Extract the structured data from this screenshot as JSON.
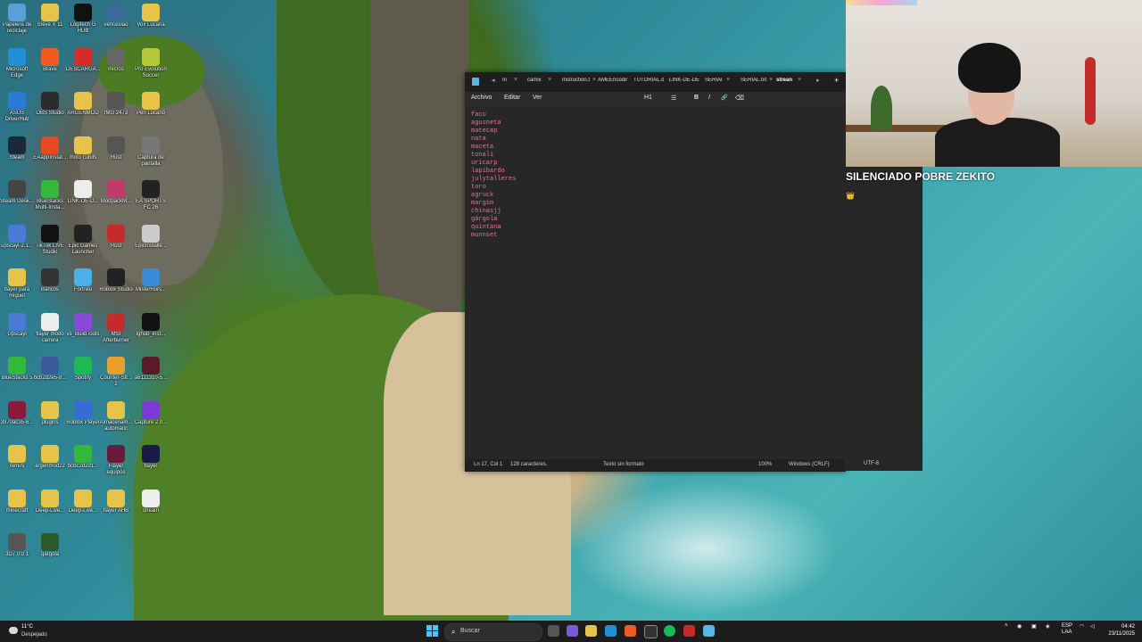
{
  "desktop": {
    "icons": [
      {
        "label": "Papelera de reciclaje",
        "icon": "recycle-bin-icon",
        "color": "#5aa0d8"
      },
      {
        "label": "Steve X 11",
        "icon": "folder-icon",
        "color": "#e8c34a"
      },
      {
        "label": "Logitech G HUB",
        "icon": "logitech-icon",
        "color": "#111111"
      },
      {
        "label": "venceslao",
        "icon": "image-icon",
        "color": "#3a6a9a"
      },
      {
        "label": "Vox Lucaria",
        "icon": "folder-icon",
        "color": "#e8c34a"
      },
      {
        "label": "Microsoft Edge",
        "icon": "edge-icon",
        "color": "#1f8fd6"
      },
      {
        "label": "Brave",
        "icon": "brave-icon",
        "color": "#f25a24"
      },
      {
        "label": "DESCARGA...",
        "icon": "pdf-icon",
        "color": "#d62b2b"
      },
      {
        "label": "micros",
        "icon": "image-icon",
        "color": "#666666"
      },
      {
        "label": "Pro Evolution Soccer",
        "icon": "game-icon",
        "color": "#b6c83a"
      },
      {
        "label": "ASUS DriverHub",
        "icon": "asus-icon",
        "color": "#2a7ad6"
      },
      {
        "label": "OBS Studio",
        "icon": "obs-icon",
        "color": "#2b2b2b"
      },
      {
        "label": "ARGENMOD",
        "icon": "folder-icon",
        "color": "#e8c34a"
      },
      {
        "label": "IMG 2473",
        "icon": "image-icon",
        "color": "#555555"
      },
      {
        "label": "Pen Lucario",
        "icon": "folder-icon",
        "color": "#e8c34a"
      },
      {
        "label": "Steam",
        "icon": "steam-icon",
        "color": "#1b2838"
      },
      {
        "label": "EAappInstal...",
        "icon": "ea-icon",
        "color": "#e84a1f"
      },
      {
        "label": "mofo cubits",
        "icon": "folder-icon",
        "color": "#e8c34a"
      },
      {
        "label": "Rust",
        "icon": "image-icon",
        "color": "#555555"
      },
      {
        "label": "Captura de pantalla",
        "icon": "image-icon",
        "color": "#777777"
      },
      {
        "label": "Steam Desk...",
        "icon": "image-icon",
        "color": "#444444"
      },
      {
        "label": "BlueStacks Multi-Insta...",
        "icon": "bluestacks-icon",
        "color": "#34b83a"
      },
      {
        "label": "LINK-DE-D...",
        "icon": "document-icon",
        "color": "#eeeeee"
      },
      {
        "label": "ModpackM...",
        "icon": "archive-icon",
        "color": "#c23a6a"
      },
      {
        "label": "EA SPORTS FC 26",
        "icon": "ea-sports-icon",
        "color": "#222222"
      },
      {
        "label": "upscayl-2.1...",
        "icon": "upscayl-icon",
        "color": "#4a7ad6"
      },
      {
        "label": "TikTok LIVE Studio",
        "icon": "tiktok-icon",
        "color": "#111111"
      },
      {
        "label": "Epic Games Launcher",
        "icon": "epic-icon",
        "color": "#222222"
      },
      {
        "label": "Rust",
        "icon": "rust-icon",
        "color": "#c62a2a"
      },
      {
        "label": "EpicInstalle...",
        "icon": "installer-icon",
        "color": "#cccccc"
      },
      {
        "label": "flayer para miguel",
        "icon": "folder-icon",
        "color": "#e8c34a"
      },
      {
        "label": "Bancos",
        "icon": "image-icon",
        "color": "#333333"
      },
      {
        "label": "Fortnite",
        "icon": "fortnite-icon",
        "color": "#4ab0e8"
      },
      {
        "label": "Roblox Studio",
        "icon": "roblox-studio-icon",
        "color": "#222222"
      },
      {
        "label": "MisterHors...",
        "icon": "app-icon",
        "color": "#3a8ad6"
      },
      {
        "label": "Upscayl",
        "icon": "upscayl-icon",
        "color": "#4a7ad6"
      },
      {
        "label": "flayer modo carrera",
        "icon": "document-icon",
        "color": "#eeeeee"
      },
      {
        "label": "vs_BuildTools",
        "icon": "visual-studio-icon",
        "color": "#8a4ad6"
      },
      {
        "label": "MSI Afterburner",
        "icon": "msi-icon",
        "color": "#c62a2a"
      },
      {
        "label": "lghub_inst...",
        "icon": "logitech-icon",
        "color": "#111111"
      },
      {
        "label": "BlueStacks 5",
        "icon": "bluestacks-icon",
        "color": "#34b83a"
      },
      {
        "label": "bcb2d2e5-8...",
        "icon": "image-icon",
        "color": "#3a5a9a"
      },
      {
        "label": "Spotify",
        "icon": "spotify-icon",
        "color": "#1db954"
      },
      {
        "label": "Counter-Str... 2",
        "icon": "cs2-icon",
        "color": "#e8a02a"
      },
      {
        "label": "a6111310-5...",
        "icon": "image-icon",
        "color": "#5a1a2a"
      },
      {
        "label": "3970ac35-6...",
        "icon": "image-icon",
        "color": "#8a1a3a"
      },
      {
        "label": "plugins",
        "icon": "folder-icon",
        "color": "#e8c34a"
      },
      {
        "label": "Roblox Player",
        "icon": "roblox-icon",
        "color": "#3a6ad6"
      },
      {
        "label": "Almacenam... automatic",
        "icon": "folder-icon",
        "color": "#e8c34a"
      },
      {
        "label": "Capture 2.0...",
        "icon": "capture-icon",
        "color": "#7a3ad6"
      },
      {
        "label": "remini",
        "icon": "folder-icon",
        "color": "#e8c34a"
      },
      {
        "label": "argenmod22",
        "icon": "folder-icon",
        "color": "#e8c34a"
      },
      {
        "label": "bcbc2d2d1...",
        "icon": "bluestacks-icon",
        "color": "#34b83a"
      },
      {
        "label": "Flayer equipos",
        "icon": "image-icon",
        "color": "#6a1a3a"
      },
      {
        "label": "flayer",
        "icon": "after-effects-icon",
        "color": "#1a1a4a"
      },
      {
        "label": "minecraft",
        "icon": "folder-icon",
        "color": "#e8c34a"
      },
      {
        "label": "Deep-Live...",
        "icon": "folder-icon",
        "color": "#e8c34a"
      },
      {
        "label": "Deep-Live...",
        "icon": "folder-icon",
        "color": "#e8c34a"
      },
      {
        "label": "flayer AHB",
        "icon": "folder-icon",
        "color": "#e8c34a"
      },
      {
        "label": "stream",
        "icon": "document-icon",
        "color": "#eeeeee"
      },
      {
        "label": "3D7 0:0 1",
        "icon": "image-icon",
        "color": "#555555"
      },
      {
        "label": "gargola",
        "icon": "image-icon",
        "color": "#2a5a2a"
      }
    ]
  },
  "notepad": {
    "tabs": [
      {
        "label": "In"
      },
      {
        "label": "camix"
      },
      {
        "label": "Instruction.t"
      },
      {
        "label": "AMEEncodir"
      },
      {
        "label": "TUTORIAL.ds"
      },
      {
        "label": "LINK-DE-DE"
      },
      {
        "label": "SERIAl"
      },
      {
        "label": "SERIAL.txt"
      },
      {
        "label": "strean"
      }
    ],
    "new_tab_symbol": "+",
    "menu": {
      "file": "Archivo",
      "edit": "Editar",
      "view": "Ver"
    },
    "format": {
      "heading": "H1",
      "list": "☰",
      "bold": "B",
      "italic": "I",
      "link": "🔗",
      "clear": "⌫"
    },
    "lines": [
      "facu",
      "agusneta",
      "matecap",
      "nata",
      "maceta",
      "tonali",
      "uricarp",
      "lapibardo",
      "julytalleres",
      "toro",
      "agruck",
      "margim",
      "chinasjj",
      "gárgola",
      "quintana",
      "munnset"
    ],
    "status": {
      "position": "Ln 17, Col 1",
      "chars": "128 caracteres.",
      "format": "Texto sin formato",
      "zoom": "100%",
      "line_endings": "Windows (CRLF)",
      "encoding": "UTF-8"
    }
  },
  "overlay": {
    "muted_text": "SILENCIADO POBRE ZEKITO",
    "sub_text": "👑"
  },
  "taskbar": {
    "weather_temp": "11°C",
    "weather_cond": "Despejado",
    "search_placeholder": "Buscar",
    "lang_top": "ESP",
    "lang_bottom": "LAA",
    "time": "04:42",
    "date": "23/11/2025"
  }
}
